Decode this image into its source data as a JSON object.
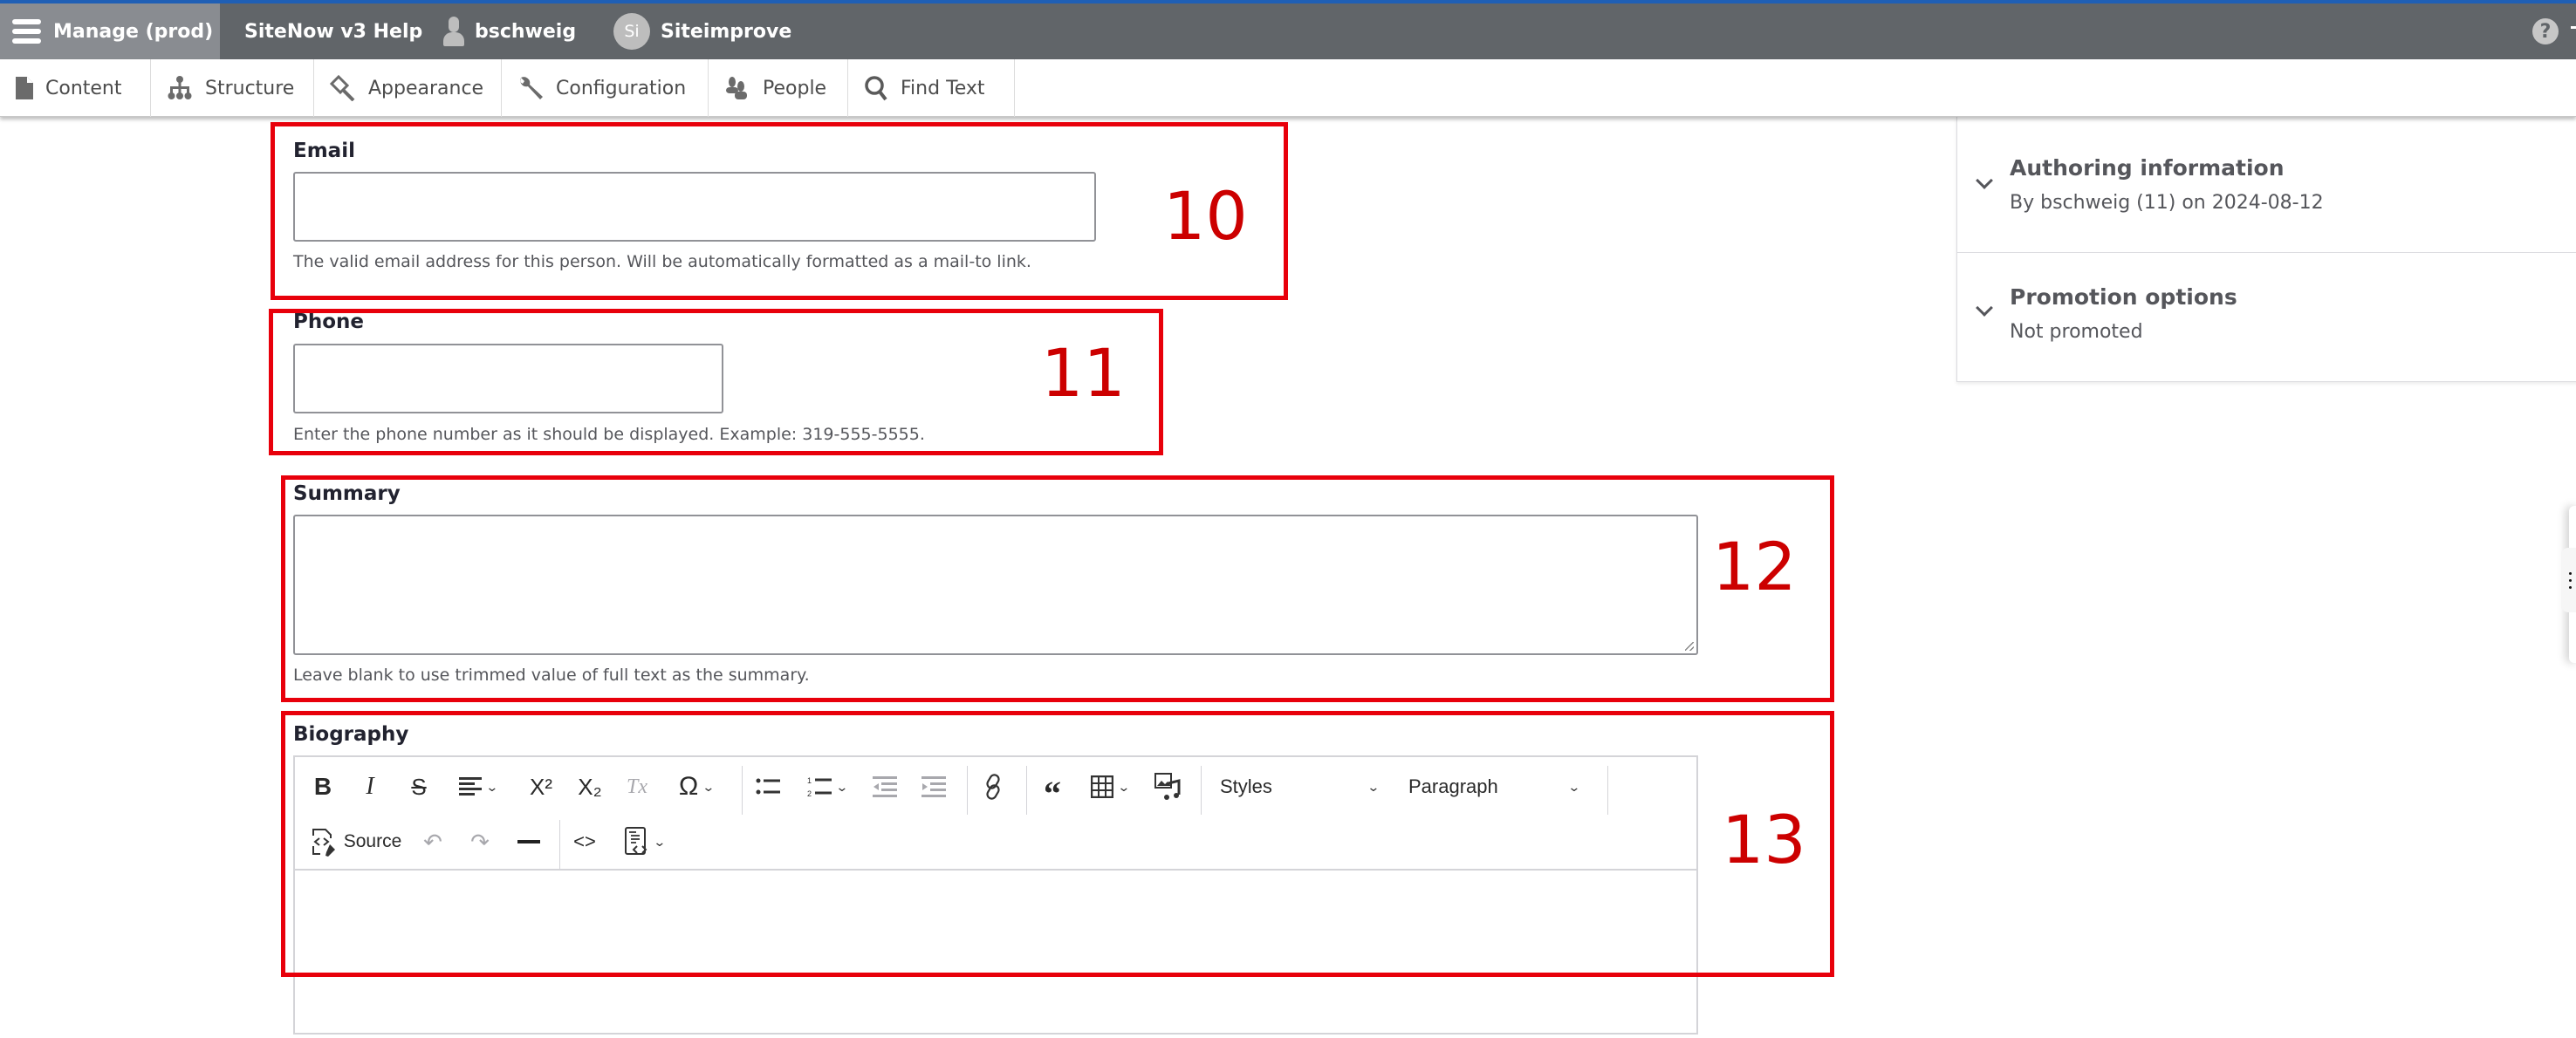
{
  "toolbar": {
    "manage_label": "Manage (prod)",
    "help_label": "SiteNow v3 Help",
    "user_label": "bschweig",
    "siteimprove_badge": "Si",
    "siteimprove_label": "Siteimprove",
    "help_icon": "?",
    "accent_color": "#1f5fb5"
  },
  "tray": {
    "items": [
      {
        "label": "Content",
        "icon": "file-icon"
      },
      {
        "label": "Structure",
        "icon": "sitemap-icon"
      },
      {
        "label": "Appearance",
        "icon": "paintbrush-icon"
      },
      {
        "label": "Configuration",
        "icon": "wrench-icon"
      },
      {
        "label": "People",
        "icon": "people-icon"
      },
      {
        "label": "Find Text",
        "icon": "search-icon"
      }
    ]
  },
  "form": {
    "email": {
      "label": "Email",
      "value": "",
      "description": "The valid email address for this person. Will be automatically formatted as a mail-to link."
    },
    "phone": {
      "label": "Phone",
      "value": "",
      "description": "Enter the phone number as it should be displayed. Example: 319-555-5555."
    },
    "summary": {
      "label": "Summary",
      "value": "",
      "description": "Leave blank to use trimmed value of full text as the summary."
    },
    "biography": {
      "label": "Biography",
      "value": "",
      "toolbar": {
        "bold": "B",
        "italic": "I",
        "strikethrough": "S",
        "superscript": "X²",
        "subscript": "X₂",
        "remove_format": "Tx",
        "special_chars": "Ω",
        "styles_label": "Styles",
        "heading_label": "Paragraph",
        "source_label": "Source"
      }
    }
  },
  "annotations": {
    "labels": [
      "10",
      "11",
      "12",
      "13"
    ],
    "color": "#e8000b"
  },
  "sidebar": {
    "sections": [
      {
        "title": "Authoring information",
        "summary": "By bschweig (11) on 2024-08-12"
      },
      {
        "title": "Promotion options",
        "summary": "Not promoted"
      }
    ]
  }
}
